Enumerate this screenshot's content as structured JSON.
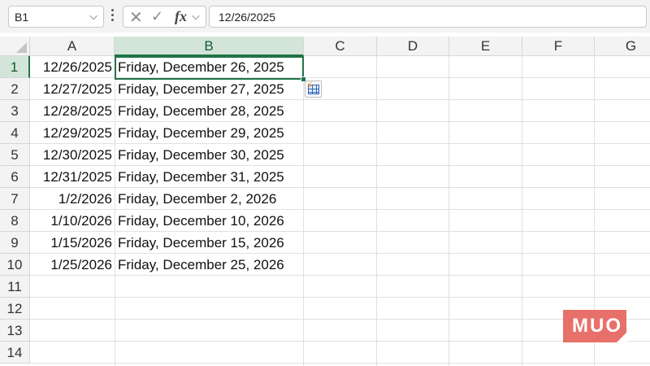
{
  "formula_bar": {
    "name_box": "B1",
    "name_box_chevron": "⌵",
    "cancel_icon": "✕",
    "enter_icon": "✓",
    "fx_label": "fx",
    "fx_chevron": "⌵",
    "formula_value": "12/26/2025"
  },
  "grid": {
    "columns": [
      "A",
      "B",
      "C",
      "D",
      "E",
      "F",
      "G"
    ],
    "selected_column": "B",
    "row_numbers": [
      "1",
      "2",
      "3",
      "4",
      "5",
      "6",
      "7",
      "8",
      "9",
      "10",
      "11",
      "12",
      "13",
      "14"
    ],
    "selected_row": "1",
    "active_cell": "B1",
    "rows": [
      {
        "a": "12/26/2025",
        "b": "Friday, December 26, 2025"
      },
      {
        "a": "12/27/2025",
        "b": "Friday, December 27, 2025"
      },
      {
        "a": "12/28/2025",
        "b": "Friday, December 28, 2025"
      },
      {
        "a": "12/29/2025",
        "b": "Friday, December 29, 2025"
      },
      {
        "a": "12/30/2025",
        "b": "Friday, December 30, 2025"
      },
      {
        "a": "12/31/2025",
        "b": "Friday, December 31, 2025"
      },
      {
        "a": "1/2/2026",
        "b": "Friday, December 2, 2026"
      },
      {
        "a": "1/10/2026",
        "b": "Friday, December 10, 2026"
      },
      {
        "a": "1/15/2026",
        "b": "Friday, December 15, 2026"
      },
      {
        "a": "1/25/2026",
        "b": "Friday, December 25, 2026"
      }
    ]
  },
  "flash_fill_icon": "flash-fill-options-icon",
  "watermark": "MUO",
  "colors": {
    "accent": "#217346",
    "selected_header_bg": "#d3e5d8",
    "watermark_bg": "#e8706a"
  }
}
